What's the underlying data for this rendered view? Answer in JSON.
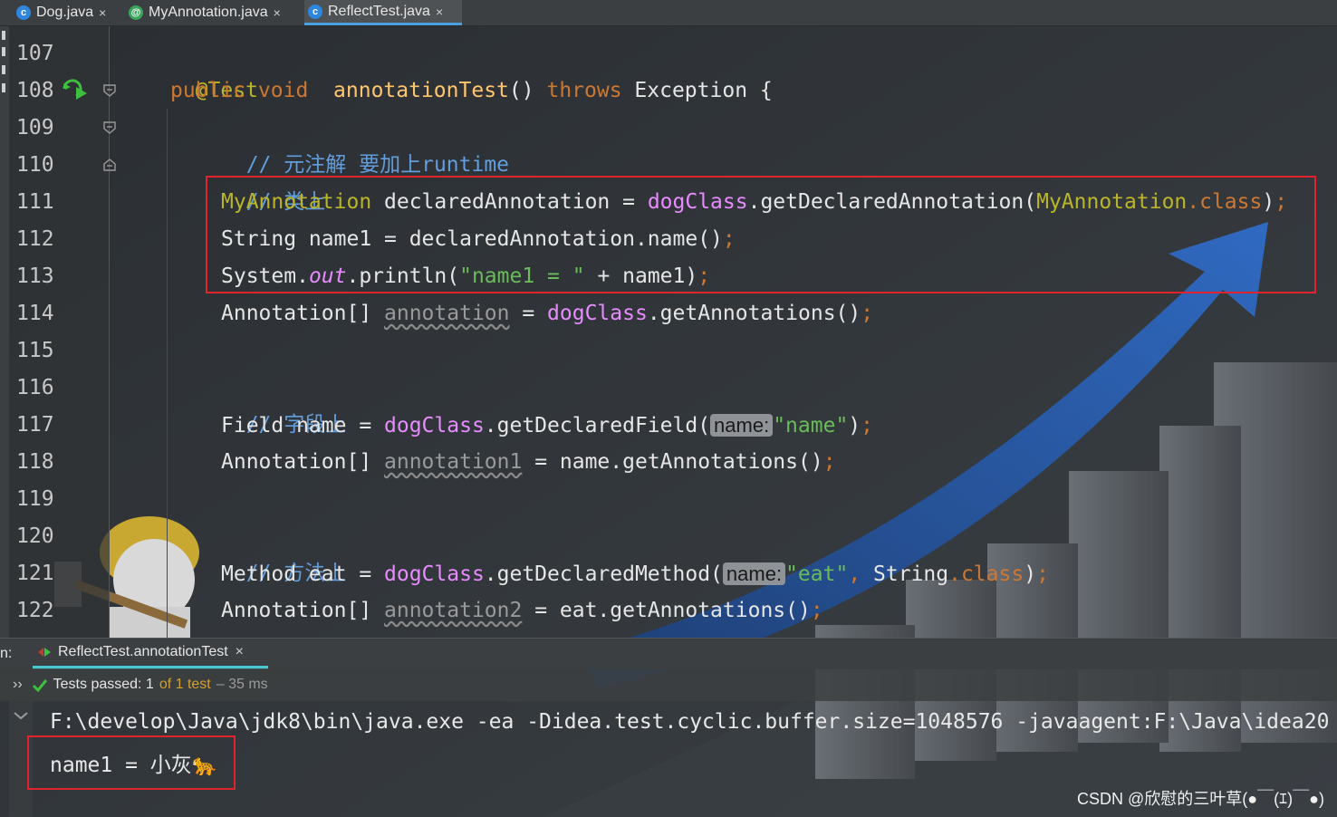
{
  "tabs": [
    {
      "label": "Dog.java",
      "icon": "class-icon",
      "close": "×"
    },
    {
      "label": "MyAnnotation.java",
      "icon": "annotation-icon",
      "close": "×"
    },
    {
      "label": "ReflectTest.java",
      "icon": "class-icon",
      "close": "×",
      "active": true
    }
  ],
  "icon_glyphs": {
    "class": "c",
    "annotation": "@"
  },
  "line_numbers": [
    "107",
    "108",
    "109",
    "110",
    "111",
    "112",
    "113",
    "114",
    "115",
    "116",
    "117",
    "118",
    "119",
    "120",
    "121",
    "122"
  ],
  "code": {
    "l107": {
      "ann": "@Test"
    },
    "l108": {
      "kw": "public void",
      "fn": "annotationTest",
      "paren": "()",
      "throws": "throws",
      "rest": "Exception {"
    },
    "l109": {
      "cmt": "// 元注解 要加上runtime"
    },
    "l110": {
      "cmt": "// 类上"
    },
    "l111": {
      "type": "MyAnnotation",
      "var": " declaredAnnotation = ",
      "field": "dogClass",
      "call": ".getDeclaredAnnotation(",
      "arg": "MyAnnotation",
      "dotclass": ".class",
      "end": ")",
      "semi": ";"
    },
    "l112": {
      "text": "String name1 = declaredAnnotation.name()",
      "semi": ";"
    },
    "l113": {
      "pre": "System.",
      "out": "out",
      "mid": ".println(",
      "str": "\"name1 = \"",
      "post": " + name1)",
      "semi": ";"
    },
    "l114": {
      "pre": "Annotation[] ",
      "unused": "annotation",
      "eq": " = ",
      "field": "dogClass",
      "post": ".getAnnotations()",
      "semi": ";"
    },
    "l116": {
      "cmt": "// 字段上"
    },
    "l117": {
      "pre": "Field name = ",
      "field": "dogClass",
      "call": ".getDeclaredField(",
      "hint": "name:",
      "str": "\"name\"",
      "end": ")",
      "semi": ";"
    },
    "l118": {
      "pre": "Annotation[] ",
      "unused": "annotation1",
      "post": " = name.getAnnotations()",
      "semi": ";"
    },
    "l120": {
      "cmt": "// 方法上"
    },
    "l121": {
      "pre": "Method eat = ",
      "field": "dogClass",
      "call": ".getDeclaredMethod(",
      "hint": "name:",
      "str": "\"eat\"",
      "comma": ",",
      "mid": " String",
      "dotclass": ".class",
      "end": ")",
      "semi": ";"
    },
    "l122": {
      "pre": "Annotation[] ",
      "unused": "annotation2",
      "post": " = eat.getAnnotations()",
      "semi": ";"
    }
  },
  "run": {
    "prefix": "n:",
    "tab_label": "ReflectTest.annotationTest",
    "close": "×",
    "chevrons": "››",
    "status_passed": "Tests passed: 1",
    "status_of": "of 1 test",
    "status_time": "– 35 ms",
    "console_lines": [
      "F:\\develop\\Java\\jdk8\\bin\\java.exe -ea -Didea.test.cyclic.buffer.size=1048576 -javaagent:F:\\Java\\idea20",
      "name1 = 小灰🐆"
    ]
  },
  "watermark": "CSDN @欣慰的三叶草(●￣(ｴ)￣●)",
  "colors": {
    "highlight_box": "#e0242d",
    "active_tab_underline": "#4a9fe0",
    "pass_green": "#3fbf3f",
    "run_tab_underline": "#4ac8d0"
  }
}
